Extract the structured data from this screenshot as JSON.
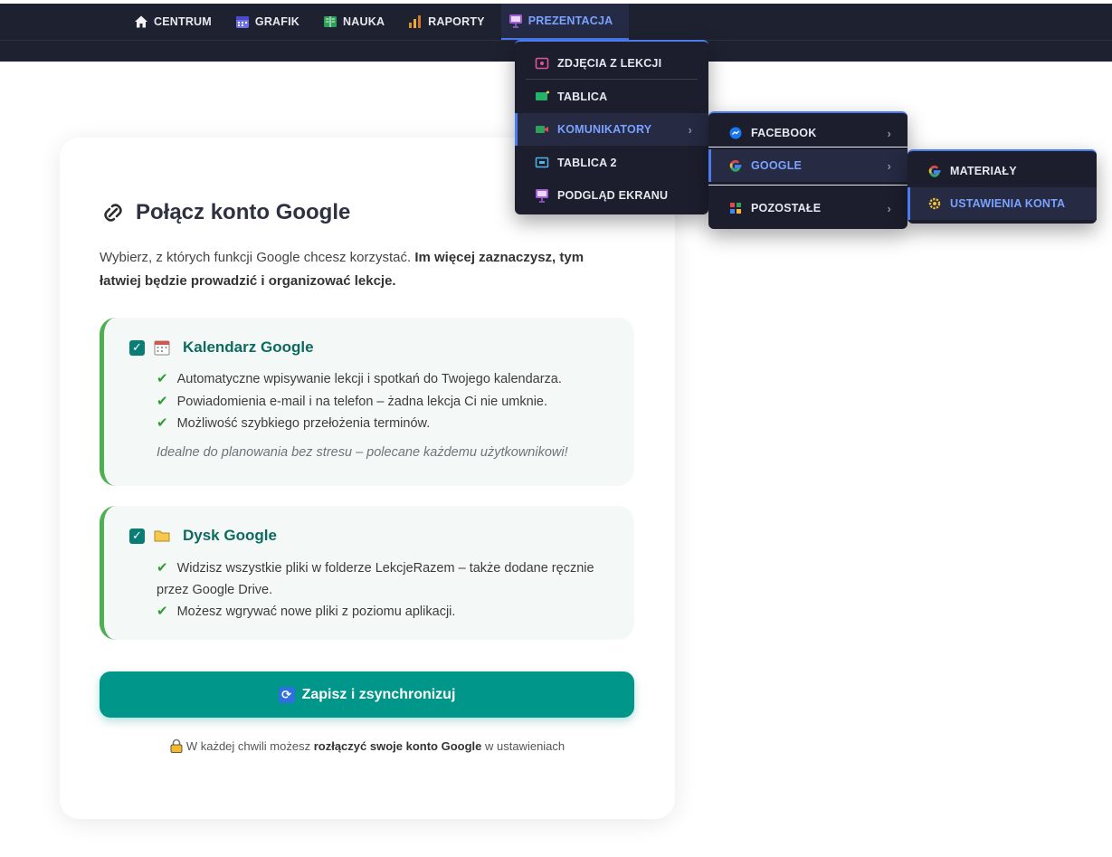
{
  "nav": {
    "items": [
      {
        "label": "CENTRUM",
        "icon": "home-icon"
      },
      {
        "label": "GRAFIK",
        "icon": "calendar-icon"
      },
      {
        "label": "NAUKA",
        "icon": "book-icon"
      },
      {
        "label": "RAPORTY",
        "icon": "bar-chart-icon"
      },
      {
        "label": "PREZENTACJA",
        "icon": "presentation-icon",
        "active": true
      }
    ]
  },
  "menu_prezentacja": {
    "items": [
      {
        "label": "ZDJĘCIA Z LEKCJI",
        "icon": "camera-icon"
      },
      {
        "label": "TABLICA",
        "icon": "whiteboard-icon"
      },
      {
        "label": "KOMUNIKATORY",
        "icon": "video-call-icon",
        "arrow": "›"
      },
      {
        "label": "TABLICA 2",
        "icon": "tablet-icon"
      },
      {
        "label": "PODGLĄD EKRANU",
        "icon": "screen-icon"
      }
    ]
  },
  "menu_komunikatory": {
    "items": [
      {
        "label": "FACEBOOK",
        "icon": "messenger-icon",
        "arrow": "›"
      },
      {
        "label": "GOOGLE",
        "icon": "google-icon",
        "arrow": "›"
      },
      {
        "label": "POZOSTAŁE",
        "icon": "grid-icon",
        "arrow": "›"
      }
    ]
  },
  "menu_google": {
    "items": [
      {
        "label": "MATERIAŁY",
        "icon": "google-icon"
      },
      {
        "label": "USTAWIENIA KONTA",
        "icon": "gear-icon"
      }
    ]
  },
  "card": {
    "title": "Połącz konto Google",
    "intro_plain": "Wybierz, z których funkcji Google chcesz korzystać. ",
    "intro_bold": "Im więcej zaznaczysz, tym łatwiej będzie prowadzić i organizować lekcje.",
    "features": [
      {
        "name": "Kalendarz Google",
        "checked": true,
        "points": [
          "Automatyczne wpisywanie lekcji i spotkań do Twojego kalendarza.",
          "Powiadomienia e-mail i na telefon – żadna lekcja Ci nie umknie.",
          "Możliwość szybkiego przełożenia terminów."
        ],
        "note": "Idealne do planowania bez stresu – polecane każdemu użytkownikowi!"
      },
      {
        "name": "Dysk Google",
        "checked": true,
        "points": [
          "Widzisz wszystkie pliki w folderze LekcjeRazem – także dodane ręcznie przez Google Drive.",
          "Możesz wgrywać nowe pliki z poziomu aplikacji."
        ]
      }
    ],
    "save_label": "Zapisz i zsynchronizuj",
    "footnote_pre": "W każdej chwili możesz ",
    "footnote_bold": "rozłączyć swoje konto Google",
    "footnote_post": " w ustawieniach"
  },
  "colors": {
    "nav_bg": "#1e2130",
    "accent_blue": "#4b7bec",
    "teal": "#00968a",
    "green_border": "#4caf50"
  }
}
